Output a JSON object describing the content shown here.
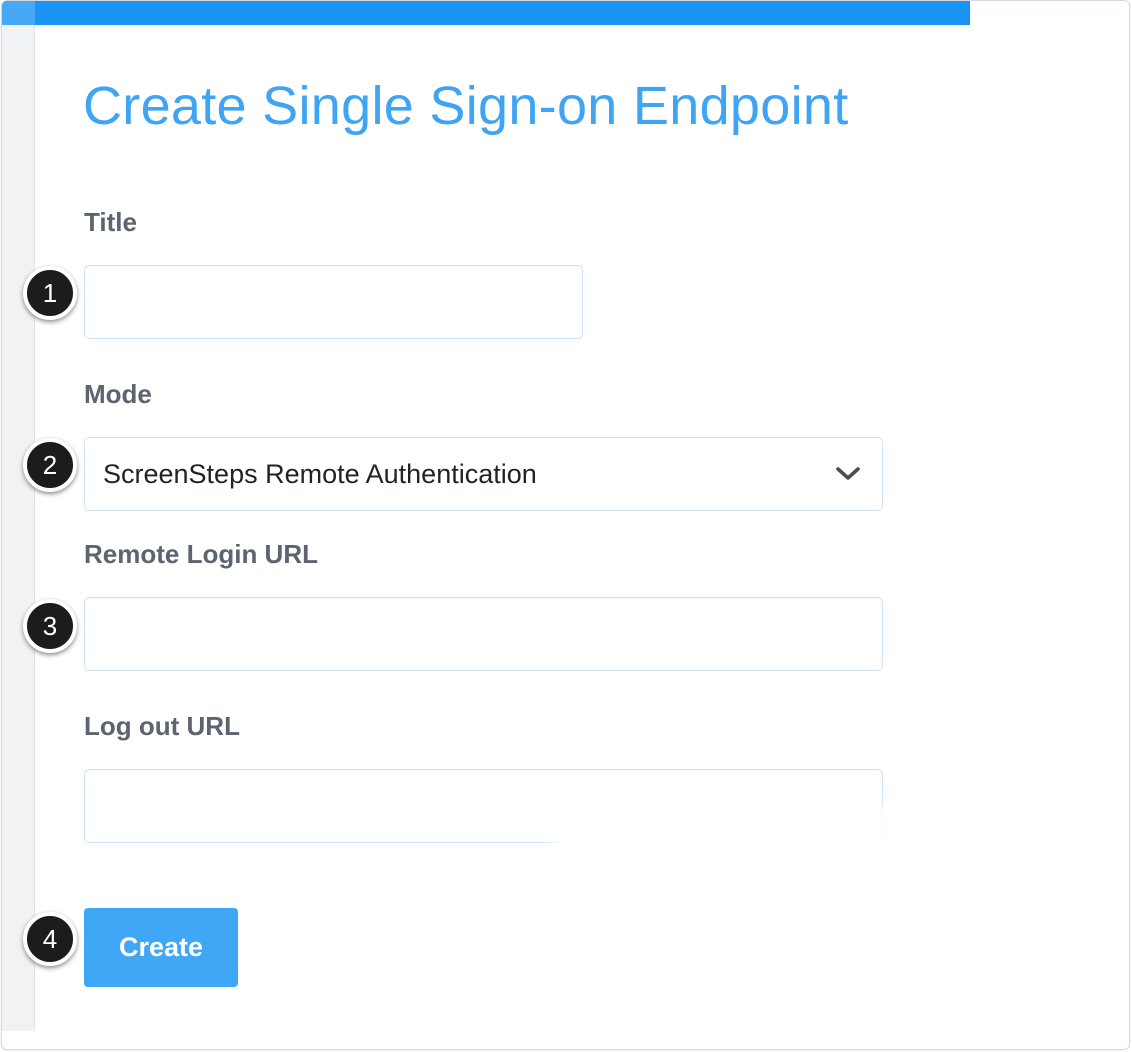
{
  "page": {
    "title": "Create Single Sign-on Endpoint"
  },
  "form": {
    "title_label": "Title",
    "title_value": "",
    "mode_label": "Mode",
    "mode_selected": "ScreenSteps Remote Authentication",
    "remote_login_label": "Remote Login URL",
    "remote_login_value": "",
    "logout_label": "Log out URL",
    "logout_value": "",
    "create_label": "Create"
  },
  "annotations": {
    "step_1": "1",
    "step_2": "2",
    "step_3": "3",
    "step_4": "4"
  },
  "colors": {
    "accent": "#1a93f5",
    "title": "#3fa4f4",
    "button": "#3fa7f6",
    "label": "#5b6470"
  },
  "icons": {
    "select_indicator": "chevron-down-icon"
  }
}
